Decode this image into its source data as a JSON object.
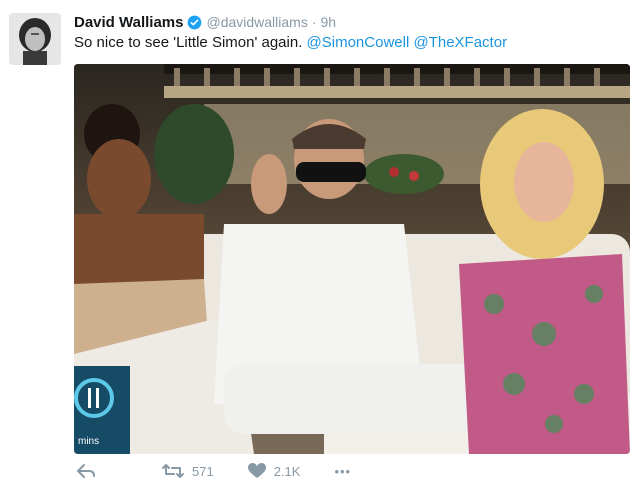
{
  "tweet": {
    "display_name": "David Walliams",
    "handle": "@davidwalliams",
    "separator": "·",
    "time": "9h",
    "text_prefix": "So nice to see 'Little Simon' again. ",
    "mention1": "@SimonCowell",
    "mention2": "@TheXFactor",
    "verified_icon": "verified-badge-icon",
    "accent_color": "#1b95e0"
  },
  "media": {
    "badge_text": "mins"
  },
  "actions": {
    "retweet_count": "571",
    "like_count": "2.1K",
    "more_label": "•••"
  }
}
